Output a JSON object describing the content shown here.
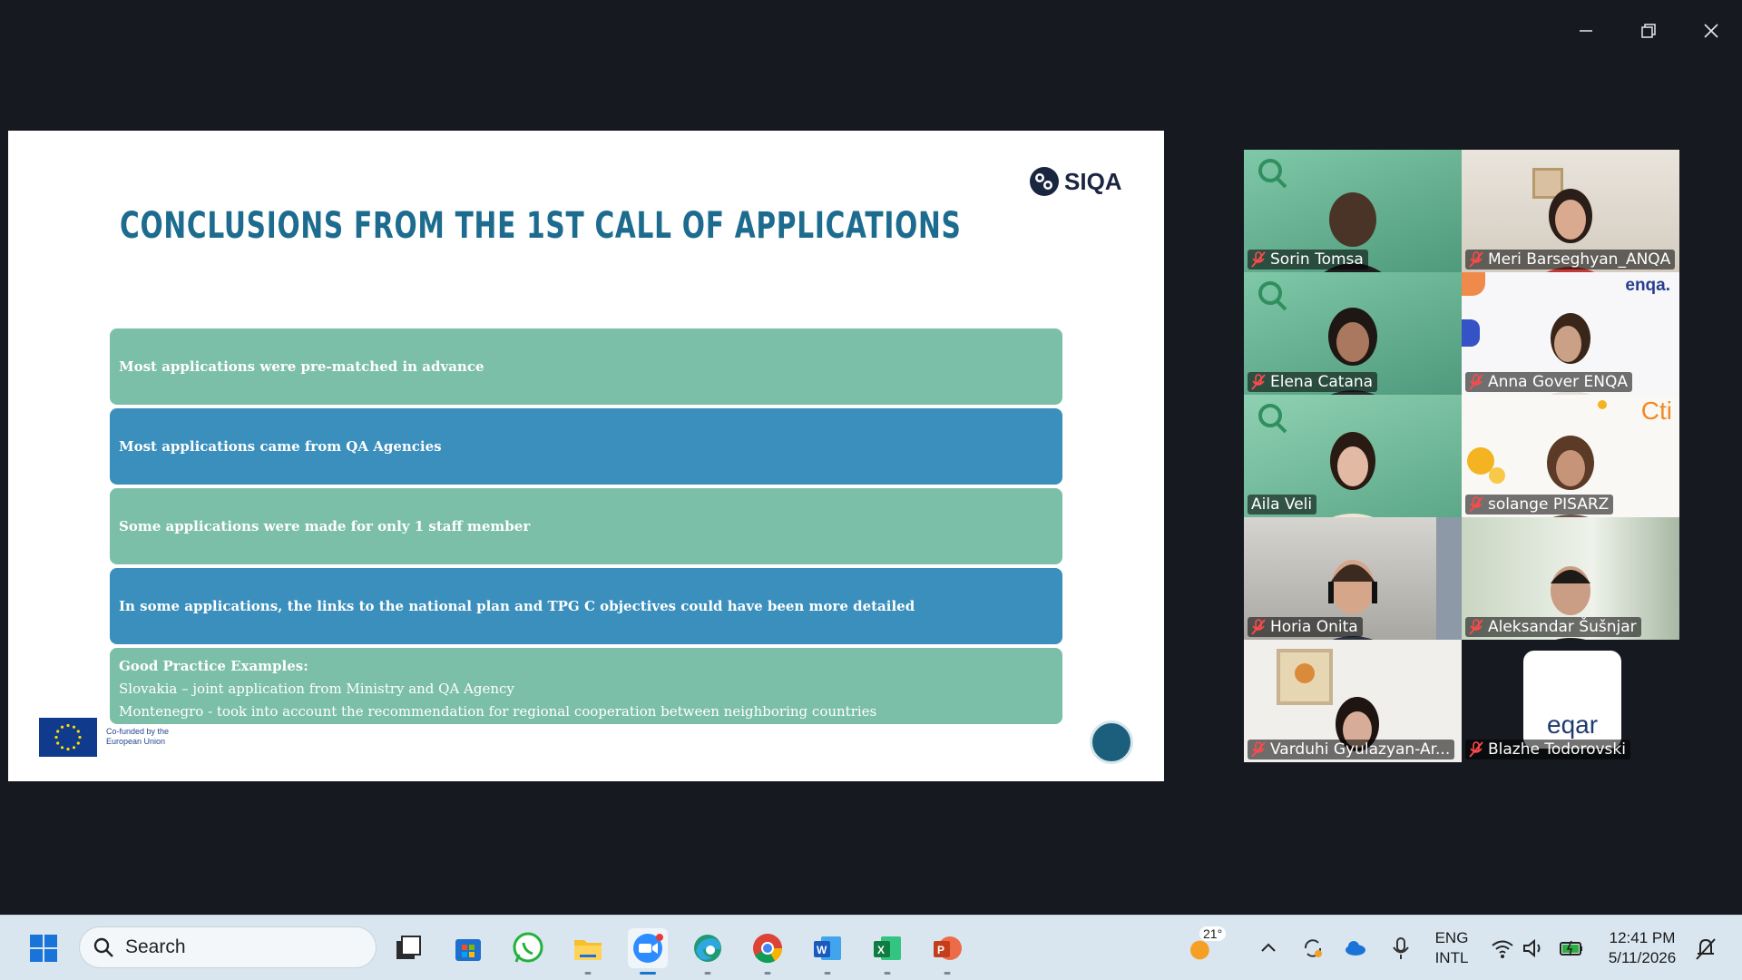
{
  "window": {
    "minimize_icon": "minimize-icon",
    "restore_icon": "restore-icon",
    "close_icon": "close-icon"
  },
  "slide": {
    "title": "CONCLUSIONS FROM THE 1ST CALL OF APPLICATIONS",
    "logo_text": "SIQA",
    "bars": [
      "Most applications were pre-matched in advance",
      "Most applications came from QA Agencies",
      "Some applications were made for only 1 staff member",
      "In some applications, the links to the national plan and TPG C objectives could have been more detailed"
    ],
    "good_practice": {
      "title": "Good Practice Examples:",
      "lines": [
        "Slovakia – joint application from Ministry and QA Agency",
        "Montenegro - took into account the recommendation for regional cooperation between neighboring countries"
      ]
    },
    "eu_label_line1": "Co-funded by the",
    "eu_label_line2": "European Union",
    "colors": {
      "title": "#1d6c8f",
      "bar_green": "#7cbfa8",
      "bar_blue": "#3a8fbd"
    }
  },
  "participants": [
    {
      "name": "Sorin Tomsa",
      "muted": true
    },
    {
      "name": "Meri Barseghyan_ANQA",
      "muted": true
    },
    {
      "name": "Elena Catana",
      "muted": true
    },
    {
      "name": "Anna Gover ENQA",
      "muted": true,
      "background_text": "enqa."
    },
    {
      "name": "Aila Veli",
      "muted": false,
      "active_speaker": true
    },
    {
      "name": "solange PISARZ",
      "muted": true,
      "background_text": "Cti"
    },
    {
      "name": "Horia Onita",
      "muted": true
    },
    {
      "name": "Aleksandar Šušnjar",
      "muted": true
    },
    {
      "name": "Varduhi Gyulazyan-Ar...",
      "muted": true
    },
    {
      "name": "Blazhe Todorovski",
      "muted": true,
      "logo_text": "eqar"
    }
  ],
  "taskbar": {
    "search_placeholder": "Search",
    "apps": [
      "windows-start-icon",
      "task-view-icon",
      "microsoft-store-icon",
      "whatsapp-icon",
      "file-explorer-icon",
      "zoom-icon",
      "edge-icon",
      "chrome-icon",
      "word-icon",
      "excel-icon",
      "powerpoint-icon"
    ],
    "weather_temp": "21°",
    "language_line1": "ENG",
    "language_line2": "INTL",
    "time": "12:41 PM",
    "date": "5/11/2026"
  }
}
